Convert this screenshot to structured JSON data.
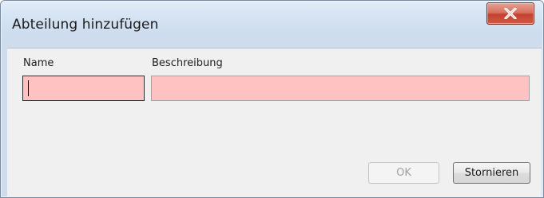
{
  "window": {
    "title": "Abteilung hinzufügen"
  },
  "form": {
    "name_label": "Name",
    "name_value": "",
    "description_label": "Beschreibung",
    "description_value": ""
  },
  "buttons": {
    "ok_label": "OK",
    "cancel_label": "Stornieren"
  },
  "icons": {
    "close": "close-icon"
  },
  "colors": {
    "invalid_field": "#ffc2c2",
    "close_button": "#c2422f"
  }
}
